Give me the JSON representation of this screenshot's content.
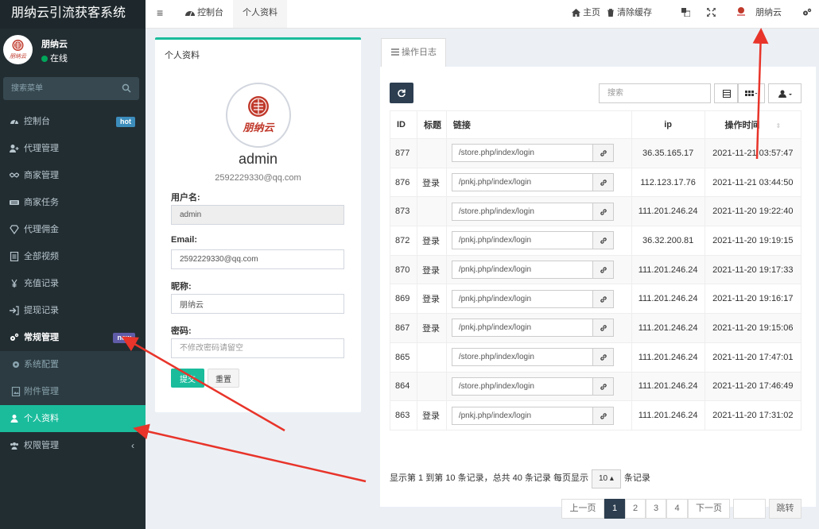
{
  "app": {
    "title": "朋纳云引流获客系统",
    "logo_text": "朋纳云"
  },
  "user": {
    "name": "朋纳云",
    "status": "在线"
  },
  "sidebar": {
    "search_placeholder": "搜索菜单",
    "items": [
      {
        "label": "控制台",
        "icon": "dashboard-icon",
        "badge": "hot",
        "badge_color": "#3c8dbc"
      },
      {
        "label": "代理管理",
        "icon": "user-plus-icon"
      },
      {
        "label": "商家管理",
        "icon": "handshake-icon"
      },
      {
        "label": "商家任务",
        "icon": "keyboard-icon"
      },
      {
        "label": "代理佣金",
        "icon": "diamond-icon"
      },
      {
        "label": "全部视频",
        "icon": "file-text-icon"
      },
      {
        "label": "充值记录",
        "icon": "yen-icon"
      },
      {
        "label": "提现记录",
        "icon": "sign-in-icon"
      },
      {
        "label": "常规管理",
        "icon": "cogs-icon",
        "badge": "new",
        "badge_color": "#605ca8"
      },
      {
        "label": "系统配置",
        "icon": "cog-icon"
      },
      {
        "label": "附件管理",
        "icon": "file-image-icon"
      },
      {
        "label": "个人资料",
        "icon": "user-icon"
      },
      {
        "label": "权限管理",
        "icon": "group-icon",
        "chevron": "‹"
      }
    ]
  },
  "topbar": {
    "menu_toggle": "≡",
    "tabs": [
      {
        "label": "控制台"
      },
      {
        "label": "个人资料"
      }
    ],
    "home": "主页",
    "clear_cache": "清除缓存",
    "username": "朋纳云"
  },
  "profile": {
    "title": "个人资料",
    "name": "admin",
    "email": "2592229330@qq.com",
    "username_label": "用户名:",
    "username_value": "admin",
    "email_label": "Email:",
    "email_value": "2592229330@qq.com",
    "nickname_label": "昵称:",
    "nickname_value": "朋纳云",
    "password_label": "密码:",
    "password_placeholder": "不修改密码请留空",
    "submit": "提交",
    "reset": "重置"
  },
  "log": {
    "tab": "操作日志",
    "search_placeholder": "搜索",
    "columns": [
      "ID",
      "标题",
      "链接",
      "ip",
      "操作时间"
    ],
    "rows": [
      {
        "id": "877",
        "title": "",
        "url": "/store.php/index/login",
        "ip": "36.35.165.17",
        "time": "2021-11-21 03:57:47"
      },
      {
        "id": "876",
        "title": "登录",
        "url": "/pnkj.php/index/login",
        "ip": "112.123.17.76",
        "time": "2021-11-21 03:44:50"
      },
      {
        "id": "873",
        "title": "",
        "url": "/store.php/index/login",
        "ip": "111.201.246.24",
        "time": "2021-11-20 19:22:40"
      },
      {
        "id": "872",
        "title": "登录",
        "url": "/pnkj.php/index/login",
        "ip": "36.32.200.81",
        "time": "2021-11-20 19:19:15"
      },
      {
        "id": "870",
        "title": "登录",
        "url": "/pnkj.php/index/login",
        "ip": "111.201.246.24",
        "time": "2021-11-20 19:17:33"
      },
      {
        "id": "869",
        "title": "登录",
        "url": "/pnkj.php/index/login",
        "ip": "111.201.246.24",
        "time": "2021-11-20 19:16:17"
      },
      {
        "id": "867",
        "title": "登录",
        "url": "/pnkj.php/index/login",
        "ip": "111.201.246.24",
        "time": "2021-11-20 19:15:06"
      },
      {
        "id": "865",
        "title": "",
        "url": "/store.php/index/login",
        "ip": "111.201.246.24",
        "time": "2021-11-20 17:47:01"
      },
      {
        "id": "864",
        "title": "",
        "url": "/store.php/index/login",
        "ip": "111.201.246.24",
        "time": "2021-11-20 17:46:49"
      },
      {
        "id": "863",
        "title": "登录",
        "url": "/pnkj.php/index/login",
        "ip": "111.201.246.24",
        "time": "2021-11-20 17:31:02"
      }
    ],
    "pagination_text_a": "显示第 1 到第 10 条记录，总共 40 条记录 每页显示",
    "page_size": "10 ▴",
    "pagination_text_b": "条记录",
    "pages": [
      "上一页",
      "1",
      "2",
      "3",
      "4",
      "下一页"
    ],
    "jump": "跳转"
  },
  "colors": {
    "accent": "#1abc9c",
    "sidebar": "#222d32",
    "link": "#3c8dbc",
    "annotation_arrow": "#e8342a"
  }
}
